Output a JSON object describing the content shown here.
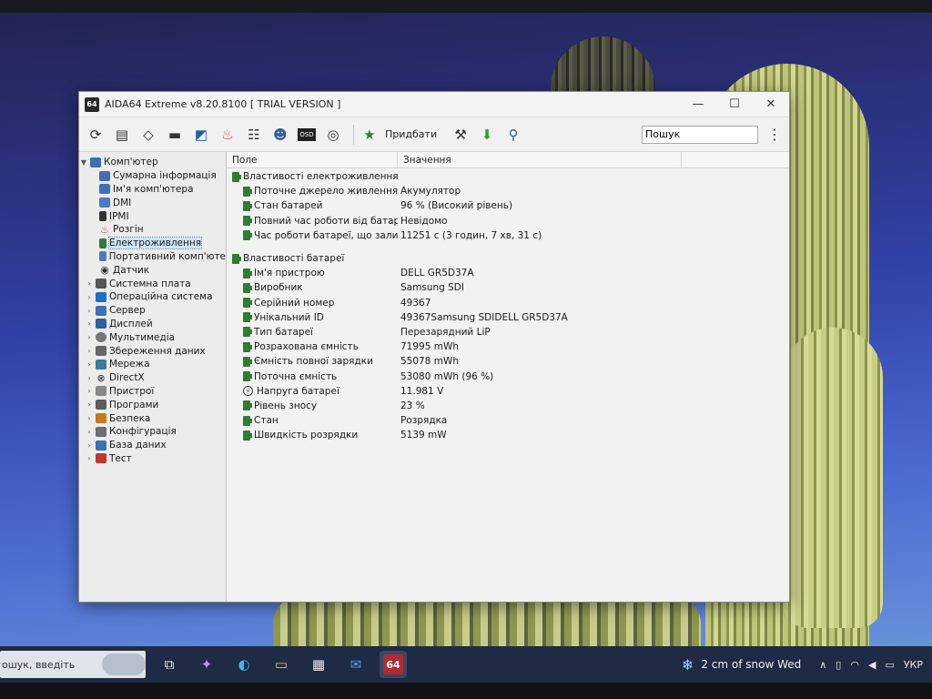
{
  "window": {
    "app_icon": "64",
    "title": "AIDA64 Extreme v8.20.8100  [ TRIAL VERSION ]",
    "min": "—",
    "max": "☐",
    "close": "✕"
  },
  "toolbar": {
    "add_label": "Придбати",
    "search_value": "Пошук"
  },
  "tree": {
    "root": "Комп'ютер",
    "children": [
      {
        "label": "Сумарна інформація",
        "icon": "computer-icon"
      },
      {
        "label": "Ім'я комп'ютера",
        "icon": "computer-icon"
      },
      {
        "label": "DMI",
        "icon": "monitor-icon"
      },
      {
        "label": "IPMI",
        "icon": "server-icon"
      },
      {
        "label": "Розгін",
        "icon": "flame-icon"
      },
      {
        "label": "Електроживлення",
        "icon": "battery-icon"
      },
      {
        "label": "Портативний комп'юте",
        "icon": "laptop-icon"
      },
      {
        "label": "Датчик",
        "icon": "gauge-icon"
      }
    ],
    "top": [
      {
        "label": "Системна плата",
        "icon": "board-icon"
      },
      {
        "label": "Операційна система",
        "icon": "windows-icon"
      },
      {
        "label": "Сервер",
        "icon": "server-icon"
      },
      {
        "label": "Дисплей",
        "icon": "monitor-icon"
      },
      {
        "label": "Мультимедіа",
        "icon": "media-icon"
      },
      {
        "label": "Збереження даних",
        "icon": "storage-icon"
      },
      {
        "label": "Мережа",
        "icon": "network-icon"
      },
      {
        "label": "DirectX",
        "icon": "directx-icon"
      },
      {
        "label": "Пристрої",
        "icon": "devices-icon"
      },
      {
        "label": "Програми",
        "icon": "programs-icon"
      },
      {
        "label": "Безпека",
        "icon": "shield-icon"
      },
      {
        "label": "Конфігурація",
        "icon": "config-icon"
      },
      {
        "label": "База даних",
        "icon": "database-icon"
      },
      {
        "label": "Тест",
        "icon": "test-icon"
      }
    ]
  },
  "list": {
    "col_field": "Поле",
    "col_value": "Значення",
    "group1": "Властивості електроживлення",
    "rows1": [
      {
        "field": "Поточне джерело живлення",
        "value": "Акумулятор"
      },
      {
        "field": "Стан батарей",
        "value": "96 % (Високий рівень)"
      },
      {
        "field": "Повний час роботи від батареї",
        "value": "Невідомо"
      },
      {
        "field": "Час роботи батареї, що залиш...",
        "value": "11251 с (3 годин, 7 хв, 31 с)"
      }
    ],
    "group2": "Властивості батареї",
    "rows2": [
      {
        "field": "Ім'я пристрою",
        "value": "DELL GR5D37A"
      },
      {
        "field": "Виробник",
        "value": "Samsung SDI"
      },
      {
        "field": "Серійний номер",
        "value": "49367"
      },
      {
        "field": "Унікальний ID",
        "value": "49367Samsung SDIDELL GR5D37A"
      },
      {
        "field": "Тип батареї",
        "value": "Перезарядний LiP"
      },
      {
        "field": "Розрахована ємність",
        "value": "71995 mWh"
      },
      {
        "field": "Ємність повної зарядки",
        "value": "55078 mWh"
      },
      {
        "field": "Поточна ємність",
        "value": "53080 mWh  (96 %)"
      },
      {
        "field": "Напруга батареї",
        "value": "11.981 V"
      },
      {
        "field": "Рівень зносу",
        "value": "23 %"
      },
      {
        "field": "Стан",
        "value": "Розрядка"
      },
      {
        "field": "Швидкість розрядки",
        "value": "5139 mW"
      }
    ]
  },
  "taskbar": {
    "search_text": "ошук, введіть",
    "aida_label": "64",
    "weather": "2 cm of snow Wed",
    "lang": "УКР"
  }
}
